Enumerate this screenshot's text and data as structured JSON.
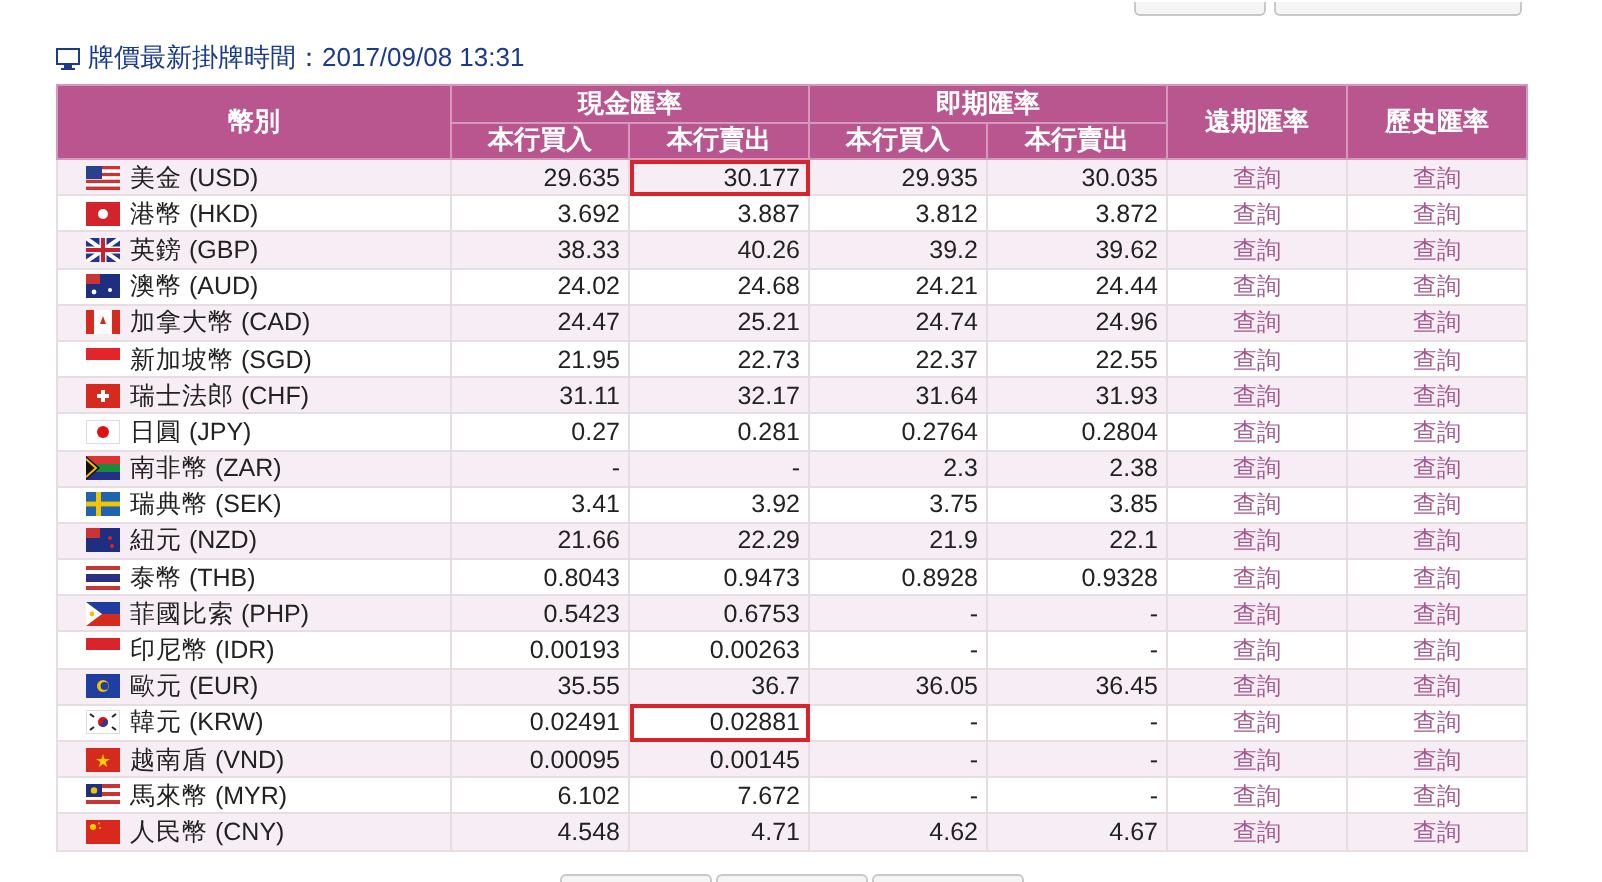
{
  "update_time": {
    "label": "牌價最新掛牌時間：2017/09/08 13:31"
  },
  "table": {
    "headers": {
      "currency": "幣別",
      "cash": "現金匯率",
      "spot": "即期匯率",
      "forward": "遠期匯率",
      "history": "歷史匯率",
      "buy": "本行買入",
      "sell": "本行賣出",
      "spot_buy": "本行買入",
      "spot_sell": "本行賣出"
    },
    "rows": [
      {
        "currency": "美金 (USD)",
        "cash_buy": "29.635",
        "cash_sell": "30.177",
        "spot_buy": "29.935",
        "spot_sell": "30.035",
        "forward": "查詢",
        "history": "查詢",
        "cash_sell_outlined": true
      },
      {
        "currency": "港幣 (HKD)",
        "cash_buy": "3.692",
        "cash_sell": "3.887",
        "spot_buy": "3.812",
        "spot_sell": "3.872",
        "forward": "查詢",
        "history": "查詢",
        "cash_sell_outlined": false
      },
      {
        "currency": "英鎊 (GBP)",
        "cash_buy": "38.33",
        "cash_sell": "40.26",
        "spot_buy": "39.2",
        "spot_sell": "39.62",
        "forward": "查詢",
        "history": "查詢",
        "cash_sell_outlined": false
      },
      {
        "currency": "澳幣 (AUD)",
        "cash_buy": "24.02",
        "cash_sell": "24.68",
        "spot_buy": "24.21",
        "spot_sell": "24.44",
        "forward": "查詢",
        "history": "查詢",
        "cash_sell_outlined": false
      },
      {
        "currency": "加拿大幣 (CAD)",
        "cash_buy": "24.47",
        "cash_sell": "25.21",
        "spot_buy": "24.74",
        "spot_sell": "24.96",
        "forward": "查詢",
        "history": "查詢",
        "cash_sell_outlined": false
      },
      {
        "currency": "新加坡幣 (SGD)",
        "cash_buy": "21.95",
        "cash_sell": "22.73",
        "spot_buy": "22.37",
        "spot_sell": "22.55",
        "forward": "查詢",
        "history": "查詢",
        "cash_sell_outlined": false
      },
      {
        "currency": "瑞士法郎 (CHF)",
        "cash_buy": "31.11",
        "cash_sell": "32.17",
        "spot_buy": "31.64",
        "spot_sell": "31.93",
        "forward": "查詢",
        "history": "查詢",
        "cash_sell_outlined": false
      },
      {
        "currency": "日圓 (JPY)",
        "cash_buy": "0.27",
        "cash_sell": "0.281",
        "spot_buy": "0.2764",
        "spot_sell": "0.2804",
        "forward": "查詢",
        "history": "查詢",
        "cash_sell_outlined": false
      },
      {
        "currency": "南非幣 (ZAR)",
        "cash_buy": "-",
        "cash_sell": "-",
        "spot_buy": "2.3",
        "spot_sell": "2.38",
        "forward": "查詢",
        "history": "查詢",
        "cash_sell_outlined": false
      },
      {
        "currency": "瑞典幣 (SEK)",
        "cash_buy": "3.41",
        "cash_sell": "3.92",
        "spot_buy": "3.75",
        "spot_sell": "3.85",
        "forward": "查詢",
        "history": "查詢",
        "cash_sell_outlined": false
      },
      {
        "currency": "紐元 (NZD)",
        "cash_buy": "21.66",
        "cash_sell": "22.29",
        "spot_buy": "21.9",
        "spot_sell": "22.1",
        "forward": "查詢",
        "history": "查詢",
        "cash_sell_outlined": false
      },
      {
        "currency": "泰幣 (THB)",
        "cash_buy": "0.8043",
        "cash_sell": "0.9473",
        "spot_buy": "0.8928",
        "spot_sell": "0.9328",
        "forward": "查詢",
        "history": "查詢",
        "cash_sell_outlined": false
      },
      {
        "currency": "菲國比索 (PHP)",
        "cash_buy": "0.5423",
        "cash_sell": "0.6753",
        "spot_buy": "-",
        "spot_sell": "-",
        "forward": "查詢",
        "history": "查詢",
        "cash_sell_outlined": false
      },
      {
        "currency": "印尼幣 (IDR)",
        "cash_buy": "0.00193",
        "cash_sell": "0.00263",
        "spot_buy": "-",
        "spot_sell": "-",
        "forward": "查詢",
        "history": "查詢",
        "cash_sell_outlined": false
      },
      {
        "currency": "歐元 (EUR)",
        "cash_buy": "35.55",
        "cash_sell": "36.7",
        "spot_buy": "36.05",
        "spot_sell": "36.45",
        "forward": "查詢",
        "history": "查詢",
        "cash_sell_outlined": false
      },
      {
        "currency": "韓元 (KRW)",
        "cash_buy": "0.02491",
        "cash_sell": "0.02881",
        "spot_buy": "-",
        "spot_sell": "-",
        "forward": "查詢",
        "history": "查詢",
        "cash_sell_outlined": true
      },
      {
        "currency": "越南盾 (VND)",
        "cash_buy": "0.00095",
        "cash_sell": "0.00145",
        "spot_buy": "-",
        "spot_sell": "-",
        "forward": "查詢",
        "history": "查詢",
        "cash_sell_outlined": false
      },
      {
        "currency": "馬來幣 (MYR)",
        "cash_buy": "6.102",
        "cash_sell": "7.672",
        "spot_buy": "-",
        "spot_sell": "-",
        "forward": "查詢",
        "history": "查詢",
        "cash_sell_outlined": false
      },
      {
        "currency": "人民幣 (CNY)",
        "cash_buy": "4.548",
        "cash_sell": "4.71",
        "spot_buy": "4.62",
        "spot_sell": "4.67",
        "forward": "查詢",
        "history": "查詢",
        "cash_sell_outlined": false
      }
    ]
  }
}
